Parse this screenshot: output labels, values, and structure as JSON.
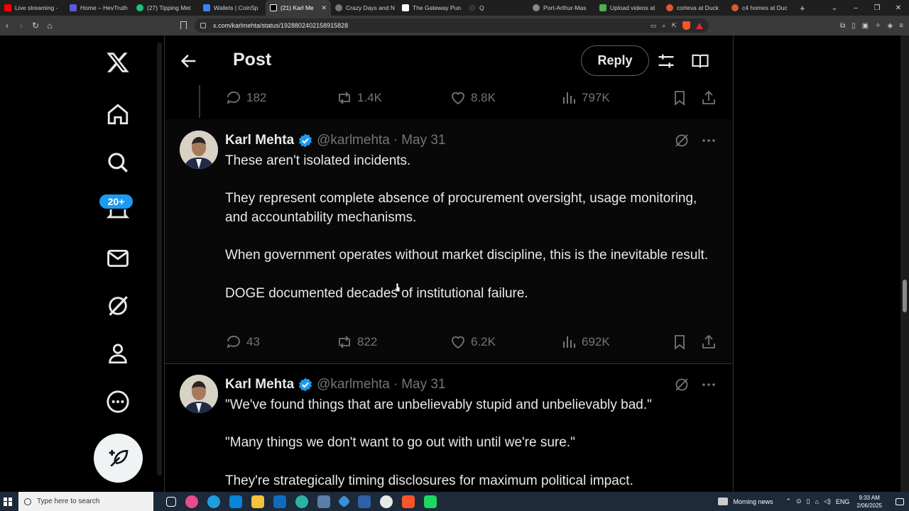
{
  "browser": {
    "tabs": [
      {
        "label": "Live streaming -",
        "color": "#ff0000"
      },
      {
        "label": "Home – HevTruth",
        "color": "#5b5bd6"
      },
      {
        "label": "(27) Tipping Met",
        "color": "#19c37d"
      },
      {
        "label": "Wallets | CoinSp",
        "color": "#3b82f6"
      },
      {
        "label": "(21) Karl Me",
        "color": "#111111",
        "active": true
      },
      {
        "label": "Crazy Days and N",
        "color": "#777777"
      },
      {
        "label": "The Gateway Pun",
        "color": "#1a1a1a"
      },
      {
        "label": "Q",
        "color": "#222222"
      },
      {
        "label": "Port-Arthur-Mas",
        "color": "#888888"
      },
      {
        "label": "Upload videos at",
        "color": "#4caf50"
      },
      {
        "label": "corteva at Duck",
        "color": "#de5833"
      },
      {
        "label": "c4 homes at Duc",
        "color": "#de5833"
      }
    ],
    "url": "x.com/karlmehta/status/1928802402158915828"
  },
  "nav": {
    "notifications_badge": "20+"
  },
  "header": {
    "title": "Post",
    "reply_label": "Reply"
  },
  "top_actions": {
    "replies": "182",
    "reposts": "1.4K",
    "likes": "8.8K",
    "views": "797K"
  },
  "tweets": [
    {
      "name": "Karl Mehta",
      "handle": "@karlmehta",
      "sep": "·",
      "date": "May 31",
      "paragraphs": [
        "These aren't isolated incidents.",
        "They represent complete absence of procurement oversight, usage monitoring, and accountability mechanisms.",
        "When government operates without market discipline, this is the inevitable result.",
        "DOGE documented decades of institutional failure."
      ],
      "replies": "43",
      "reposts": "822",
      "likes": "6.2K",
      "views": "692K"
    },
    {
      "name": "Karl Mehta",
      "handle": "@karlmehta",
      "sep": "·",
      "date": "May 31",
      "paragraphs": [
        "\"We've found things that are unbelievably stupid and unbelievably bad.\"",
        "\"Many things we don't want to go out with until we're sure.\"",
        "They're strategically timing disclosures for maximum political impact."
      ]
    }
  ],
  "taskbar": {
    "search_placeholder": "Type here to search",
    "news": "Morning news",
    "lang": "ENG",
    "time": "9:33 AM",
    "date": "2/06/2025"
  },
  "colors": {
    "accent": "#1d9bf0",
    "text": "#e7e9ea",
    "muted": "#71767b",
    "border": "#2f3336"
  }
}
